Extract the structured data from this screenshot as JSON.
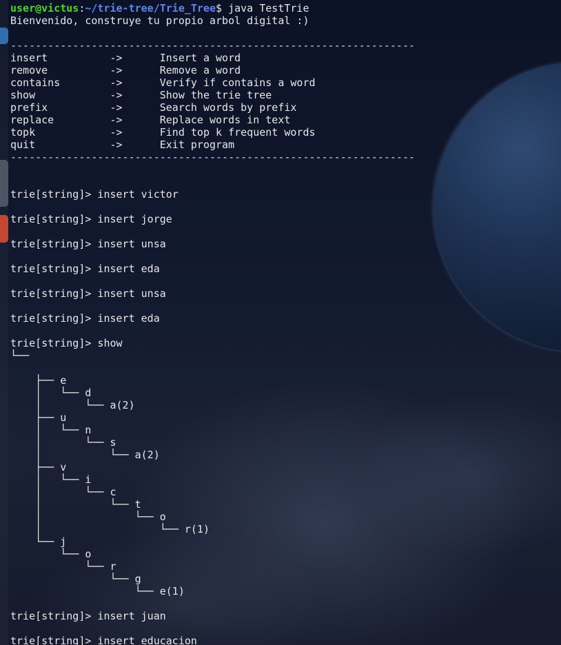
{
  "terminal": {
    "prompt": {
      "user_host": "user@victus",
      "colon": ":",
      "path": "~/trie-tree/Trie_Tree",
      "symbol": "$ ",
      "command": "java TestTrie"
    },
    "lines": [
      {
        "kind": "output",
        "text": "Bienvenido, construye tu propio arbol digital :)"
      },
      {
        "kind": "blank",
        "text": ""
      },
      {
        "kind": "separator",
        "text": "-----------------------------------------------------------------"
      },
      {
        "kind": "menu",
        "text": "insert          ->      Insert a word"
      },
      {
        "kind": "menu",
        "text": "remove          ->      Remove a word"
      },
      {
        "kind": "menu",
        "text": "contains        ->      Verify if contains a word"
      },
      {
        "kind": "menu",
        "text": "show            ->      Show the trie tree"
      },
      {
        "kind": "menu",
        "text": "prefix          ->      Search words by prefix"
      },
      {
        "kind": "menu",
        "text": "replace         ->      Replace words in text"
      },
      {
        "kind": "menu",
        "text": "topk            ->      Find top k frequent words"
      },
      {
        "kind": "menu",
        "text": "quit            ->      Exit program"
      },
      {
        "kind": "separator",
        "text": "-----------------------------------------------------------------"
      },
      {
        "kind": "blank",
        "text": ""
      },
      {
        "kind": "blank",
        "text": ""
      },
      {
        "kind": "command",
        "text": "trie[string]> insert victor"
      },
      {
        "kind": "blank",
        "text": ""
      },
      {
        "kind": "command",
        "text": "trie[string]> insert jorge"
      },
      {
        "kind": "blank",
        "text": ""
      },
      {
        "kind": "command",
        "text": "trie[string]> insert unsa"
      },
      {
        "kind": "blank",
        "text": ""
      },
      {
        "kind": "command",
        "text": "trie[string]> insert eda"
      },
      {
        "kind": "blank",
        "text": ""
      },
      {
        "kind": "command",
        "text": "trie[string]> insert unsa"
      },
      {
        "kind": "blank",
        "text": ""
      },
      {
        "kind": "command",
        "text": "trie[string]> insert eda"
      },
      {
        "kind": "blank",
        "text": ""
      },
      {
        "kind": "command",
        "text": "trie[string]> show"
      },
      {
        "kind": "tree",
        "text": "└──"
      },
      {
        "kind": "blank",
        "text": ""
      },
      {
        "kind": "tree",
        "text": "    ├── e"
      },
      {
        "kind": "tree",
        "text": "    │   └── d"
      },
      {
        "kind": "tree",
        "text": "    │       └── a(2)"
      },
      {
        "kind": "tree",
        "text": "    ├── u"
      },
      {
        "kind": "tree",
        "text": "    │   └── n"
      },
      {
        "kind": "tree",
        "text": "    │       └── s"
      },
      {
        "kind": "tree",
        "text": "    │           └── a(2)"
      },
      {
        "kind": "tree",
        "text": "    ├── v"
      },
      {
        "kind": "tree",
        "text": "    │   └── i"
      },
      {
        "kind": "tree",
        "text": "    │       └── c"
      },
      {
        "kind": "tree",
        "text": "    │           └── t"
      },
      {
        "kind": "tree",
        "text": "    │               └── o"
      },
      {
        "kind": "tree",
        "text": "    │                   └── r(1)"
      },
      {
        "kind": "tree",
        "text": "    └── j"
      },
      {
        "kind": "tree",
        "text": "        └── o"
      },
      {
        "kind": "tree",
        "text": "            └── r"
      },
      {
        "kind": "tree",
        "text": "                └── g"
      },
      {
        "kind": "tree",
        "text": "                    └── e(1)"
      },
      {
        "kind": "blank",
        "text": ""
      },
      {
        "kind": "command",
        "text": "trie[string]> insert juan"
      },
      {
        "kind": "blank",
        "text": ""
      },
      {
        "kind": "command",
        "text": "trie[string]> insert educacion"
      }
    ]
  },
  "colors": {
    "prompt_user": "#4fd52a",
    "prompt_path": "#5f87e8",
    "text": "#e8e8e8",
    "background": "#0c1226"
  }
}
